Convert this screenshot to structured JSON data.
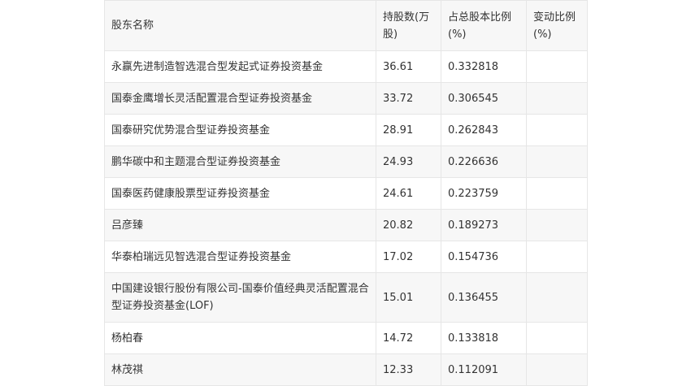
{
  "table": {
    "headers": [
      "股东名称",
      "持股数(万股)",
      "占总股本比例(%)",
      "变动比例(%)"
    ],
    "rows": [
      {
        "name": "永赢先进制造智选混合型发起式证券投资基金",
        "shares": "36.61",
        "ratio": "0.332818",
        "change": ""
      },
      {
        "name": "国泰金鹰增长灵活配置混合型证券投资基金",
        "shares": "33.72",
        "ratio": "0.306545",
        "change": ""
      },
      {
        "name": "国泰研究优势混合型证券投资基金",
        "shares": "28.91",
        "ratio": "0.262843",
        "change": ""
      },
      {
        "name": "鹏华碳中和主题混合型证券投资基金",
        "shares": "24.93",
        "ratio": "0.226636",
        "change": ""
      },
      {
        "name": "国泰医药健康股票型证券投资基金",
        "shares": "24.61",
        "ratio": "0.223759",
        "change": ""
      },
      {
        "name": "吕彦臻",
        "shares": "20.82",
        "ratio": "0.189273",
        "change": ""
      },
      {
        "name": "华泰柏瑞远见智选混合型证券投资基金",
        "shares": "17.02",
        "ratio": "0.154736",
        "change": ""
      },
      {
        "name": "中国建设银行股份有限公司-国泰价值经典灵活配置混合型证券投资基金(LOF)",
        "shares": "15.01",
        "ratio": "0.136455",
        "change": ""
      },
      {
        "name": "杨柏春",
        "shares": "14.72",
        "ratio": "0.133818",
        "change": ""
      },
      {
        "name": "林茂祺",
        "shares": "12.33",
        "ratio": "0.112091",
        "change": ""
      }
    ]
  }
}
